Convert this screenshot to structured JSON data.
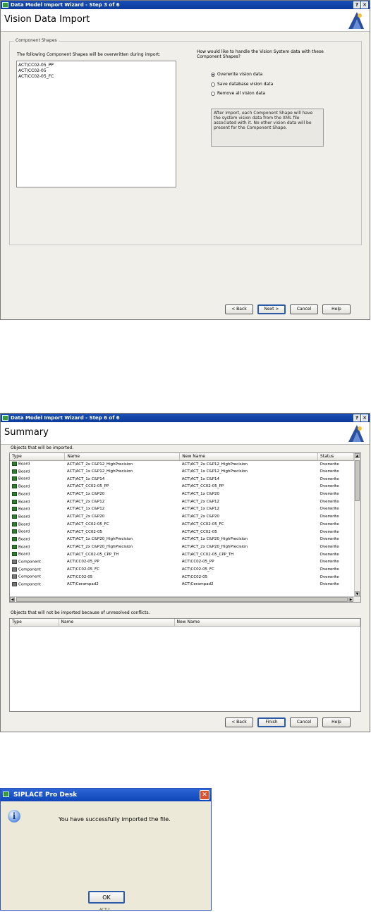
{
  "step3": {
    "window_title": "Data Model Import Wizard - Step 3 of 6",
    "header_title": "Vision Data Import",
    "group_label": "Component Shapes",
    "list_caption": "The following Component Shapes will be overwritten during import:",
    "list_items": [
      "ACT\\CC02-05_PP",
      "ACT\\CC02-05",
      "ACT\\CC02-05_FC"
    ],
    "question": "How would like to handle the Vision System data with these Component Shapes?",
    "options": [
      {
        "label": "Overwrite vision data",
        "selected": true
      },
      {
        "label": "Save database vision data",
        "selected": false
      },
      {
        "label": "Remove all vision data",
        "selected": false
      }
    ],
    "info_text": "After import, each Component Shape will have the system vision data from the XML file associated with it. No other vision data will be present for the Component Shape.",
    "buttons": {
      "back": "< Back",
      "next": "Next >",
      "cancel": "Cancel",
      "help": "Help"
    }
  },
  "step6": {
    "window_title": "Data Model Import Wizard - Step 6 of 6",
    "header_title": "Summary",
    "imported_caption": "Objects that will be imported.",
    "imported_columns": [
      "Type",
      "Name",
      "New Name",
      "Status"
    ],
    "imported_rows": [
      {
        "type": "Board",
        "icon": "board-icon",
        "name": "ACT\\ACT_2x C&P12_HighPrecision",
        "new_name": "ACT\\ACT_2x C&P12_HighPrecision",
        "status": "Overwrite"
      },
      {
        "type": "Board",
        "icon": "board-icon",
        "name": "ACT\\ACT_1x C&P12_HighPrecision",
        "new_name": "ACT\\ACT_1x C&P12_HighPrecision",
        "status": "Overwrite"
      },
      {
        "type": "Board",
        "icon": "board-icon",
        "name": "ACT\\ACT_1x C&P14",
        "new_name": "ACT\\ACT_1x C&P14",
        "status": "Overwrite"
      },
      {
        "type": "Board",
        "icon": "board-icon",
        "name": "ACT\\ACT_CC02-05_PP",
        "new_name": "ACT\\ACT_CC02-05_PP",
        "status": "Overwrite"
      },
      {
        "type": "Board",
        "icon": "board-icon",
        "name": "ACT\\ACT_1x C&P20",
        "new_name": "ACT\\ACT_1x C&P20",
        "status": "Overwrite"
      },
      {
        "type": "Board",
        "icon": "board-icon",
        "name": "ACT\\ACT_2x C&P12",
        "new_name": "ACT\\ACT_2x C&P12",
        "status": "Overwrite"
      },
      {
        "type": "Board",
        "icon": "board-icon",
        "name": "ACT\\ACT_1x C&P12",
        "new_name": "ACT\\ACT_1x C&P12",
        "status": "Overwrite"
      },
      {
        "type": "Board",
        "icon": "board-icon",
        "name": "ACT\\ACT_2x C&P20",
        "new_name": "ACT\\ACT_2x C&P20",
        "status": "Overwrite"
      },
      {
        "type": "Board",
        "icon": "board-icon",
        "name": "ACT\\ACT_CC02-05_FC",
        "new_name": "ACT\\ACT_CC02-05_FC",
        "status": "Overwrite"
      },
      {
        "type": "Board",
        "icon": "board-icon",
        "name": "ACT\\ACT_CC02-05",
        "new_name": "ACT\\ACT_CC02-05",
        "status": "Overwrite"
      },
      {
        "type": "Board",
        "icon": "board-icon",
        "name": "ACT\\ACT_1x C&P20_HighPrecision",
        "new_name": "ACT\\ACT_1x C&P20_HighPrecision",
        "status": "Overwrite"
      },
      {
        "type": "Board",
        "icon": "board-icon",
        "name": "ACT\\ACT_2x C&P20_HighPrecision",
        "new_name": "ACT\\ACT_2x C&P20_HighPrecision",
        "status": "Overwrite"
      },
      {
        "type": "Board",
        "icon": "board-icon",
        "name": "ACT\\ACT_CC02-05_CPP_TH",
        "new_name": "ACT\\ACT_CC02-05_CPP_TH",
        "status": "Overwrite"
      },
      {
        "type": "Component",
        "icon": "component-icon",
        "name": "ACT\\CC02-05_PP",
        "new_name": "ACT\\CC02-05_PP",
        "status": "Overwrite"
      },
      {
        "type": "Component",
        "icon": "component-icon",
        "name": "ACT\\CC02-05_FC",
        "new_name": "ACT\\CC02-05_FC",
        "status": "Overwrite"
      },
      {
        "type": "Component",
        "icon": "component-icon",
        "name": "ACT\\CC02-05",
        "new_name": "ACT\\CC02-05",
        "status": "Overwrite"
      },
      {
        "type": "Component",
        "icon": "component-icon",
        "name": "ACT\\Cerampad2",
        "new_name": "ACT\\Cerampad2",
        "status": "Overwrite"
      }
    ],
    "conflicts_caption": "Objects that will not be imported because of unresolved conflicts.",
    "conflicts_columns": [
      "Type",
      "Name",
      "New Name"
    ],
    "buttons": {
      "back": "< Back",
      "finish": "Finish",
      "cancel": "Cancel",
      "help": "Help"
    }
  },
  "message_box": {
    "title": "SIPLACE Pro Desk",
    "message": "You have successfully imported the file.",
    "ok_label": "OK",
    "caption_below": "ACT\\2"
  },
  "colors": {
    "titlebar": "#0b3a9a",
    "board_icon": "#2e7d2e",
    "component_icon": "#777777"
  }
}
